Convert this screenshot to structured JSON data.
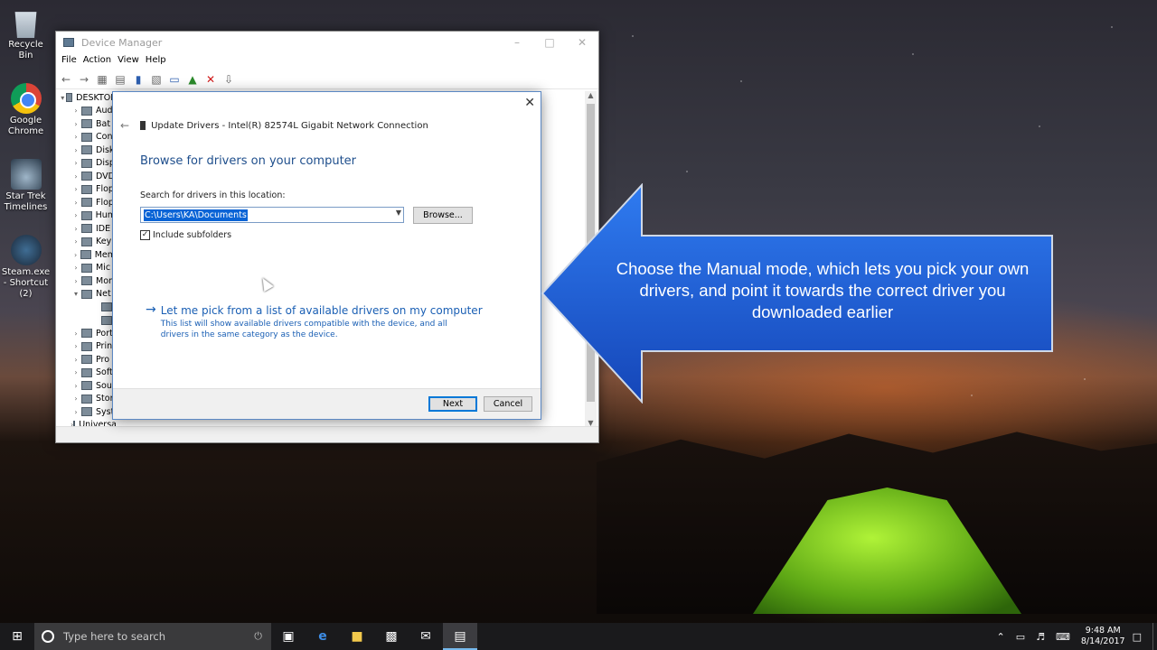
{
  "desktop": {
    "icons": [
      {
        "label": "Recycle Bin"
      },
      {
        "label": "Google Chrome"
      },
      {
        "label": "Star Trek Timelines"
      },
      {
        "label": "Steam.exe - Shortcut (2)"
      }
    ]
  },
  "device_manager": {
    "title": "Device Manager",
    "menu": [
      "File",
      "Action",
      "View",
      "Help"
    ],
    "tree": [
      {
        "label": "DESKTOP",
        "arrow": "▾"
      },
      {
        "label": "Aud",
        "arrow": "›"
      },
      {
        "label": "Bat",
        "arrow": "›"
      },
      {
        "label": "Con",
        "arrow": "›"
      },
      {
        "label": "Disk",
        "arrow": "›"
      },
      {
        "label": "Disp",
        "arrow": "›"
      },
      {
        "label": "DVD",
        "arrow": "›"
      },
      {
        "label": "Flop",
        "arrow": "›"
      },
      {
        "label": "Flop",
        "arrow": "›"
      },
      {
        "label": "Hum",
        "arrow": "›"
      },
      {
        "label": "IDE",
        "arrow": "›"
      },
      {
        "label": "Key",
        "arrow": "›"
      },
      {
        "label": "Mem",
        "arrow": "›"
      },
      {
        "label": "Mic",
        "arrow": "›"
      },
      {
        "label": "Mon",
        "arrow": "›"
      },
      {
        "label": "Net",
        "arrow": "▾"
      },
      {
        "label": "",
        "arrow": ""
      },
      {
        "label": "",
        "arrow": ""
      },
      {
        "label": "Port",
        "arrow": "›"
      },
      {
        "label": "Prin",
        "arrow": "›"
      },
      {
        "label": "Pro",
        "arrow": "›"
      },
      {
        "label": "Soft",
        "arrow": "›"
      },
      {
        "label": "Sou",
        "arrow": "›"
      },
      {
        "label": "Stor",
        "arrow": "›"
      },
      {
        "label": "Syst",
        "arrow": "›"
      },
      {
        "label": "Universal Serial Bus controllers",
        "arrow": "›"
      }
    ]
  },
  "update_drivers": {
    "header": "Update Drivers - Intel(R) 82574L Gigabit Network Connection",
    "heading": "Browse for drivers on your computer",
    "search_label": "Search for drivers in this location:",
    "path_value": "C:\\Users\\KA\\Documents",
    "browse_label": "Browse...",
    "include_subfolders_label": "Include subfolders",
    "include_subfolders_checked": true,
    "pick_link_title": "Let me pick from a list of available drivers on my computer",
    "pick_link_desc": "This list will show available drivers compatible with the device, and all drivers in the same category as the device.",
    "next_label": "Next",
    "cancel_label": "Cancel"
  },
  "callout": {
    "text": "Choose the Manual mode, which lets you pick your own drivers, and point it towards the correct driver you downloaded earlier",
    "color": "#1f5fd6"
  },
  "taskbar": {
    "search_placeholder": "Type here to search",
    "time": "9:48 AM",
    "date": "8/14/2017"
  }
}
